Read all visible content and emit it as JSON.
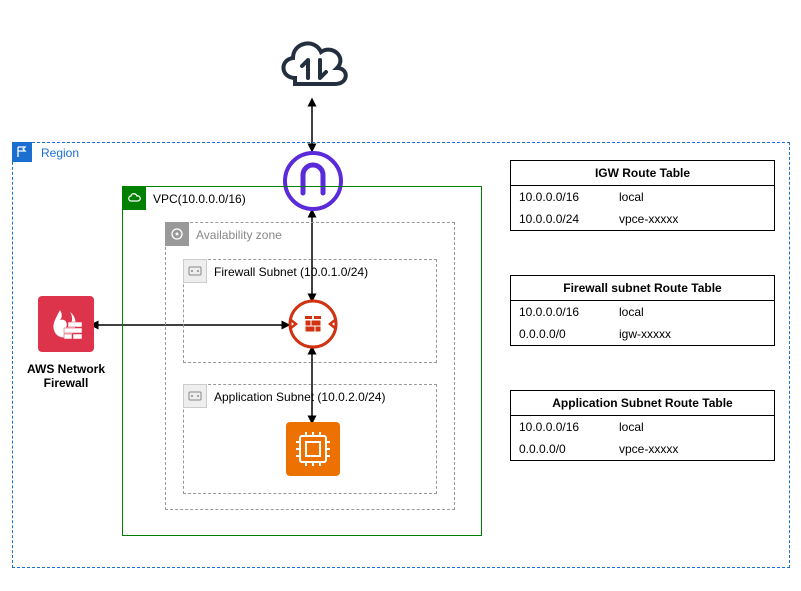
{
  "region": {
    "label": "Region"
  },
  "vpc": {
    "label": "VPC(10.0.0.0/16)"
  },
  "az": {
    "label": "Availability zone"
  },
  "fw_subnet": {
    "label": "Firewall Subnet   (10.0.1.0/24)"
  },
  "app_subnet": {
    "label": "Application Subnet (10.0.2.0/24)"
  },
  "aws_nfw": {
    "l1": "AWS Network",
    "l2": "Firewall"
  },
  "tables": {
    "igw": {
      "title": "IGW Route Table",
      "rows": [
        {
          "dest": "10.0.0.0/16",
          "target": "local"
        },
        {
          "dest": "10.0.0.0/24",
          "target": "vpce-xxxxx"
        }
      ]
    },
    "fw": {
      "title": "Firewall subnet Route Table",
      "rows": [
        {
          "dest": "10.0.0.0/16",
          "target": "local"
        },
        {
          "dest": "0.0.0.0/0",
          "target": "igw-xxxxx"
        }
      ]
    },
    "app": {
      "title": "Application Subnet Route Table",
      "rows": [
        {
          "dest": "10.0.0.0/16",
          "target": "local"
        },
        {
          "dest": "0.0.0.0/0",
          "target": "vpce-xxxxx"
        }
      ]
    }
  }
}
